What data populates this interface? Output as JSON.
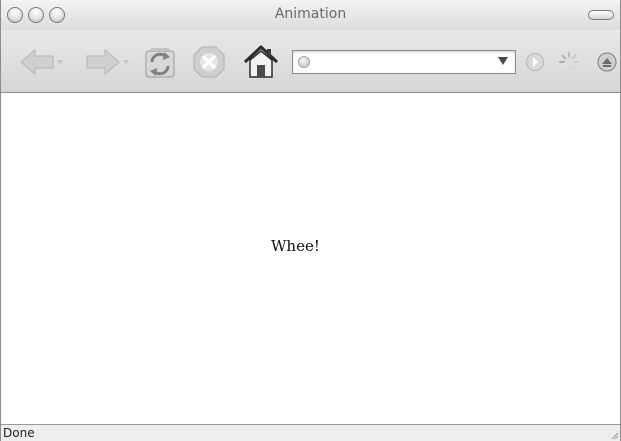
{
  "window": {
    "title": "Animation"
  },
  "toolbar": {
    "buttons": [
      {
        "name": "back-button",
        "icon": "back-arrow-icon"
      },
      {
        "name": "forward-button",
        "icon": "forward-arrow-icon"
      },
      {
        "name": "reload-button",
        "icon": "reload-icon"
      },
      {
        "name": "stop-button",
        "icon": "stop-icon"
      },
      {
        "name": "home-button",
        "icon": "home-icon"
      },
      {
        "name": "go-button",
        "icon": "go-icon"
      },
      {
        "name": "activity-throbber",
        "icon": "spinner-icon"
      },
      {
        "name": "extra-button",
        "icon": "download-icon"
      }
    ],
    "url": {
      "value": "",
      "favicon": "page-favicon-icon",
      "dropdown_icon": "dropdown-triangle-icon"
    }
  },
  "content": {
    "text": "Whee!"
  },
  "status": {
    "text": "Done"
  },
  "colors": {
    "toolbar_bg": "#dcdcdc",
    "content_bg": "#ffffff",
    "icon_gray": "#c8c8c8"
  }
}
